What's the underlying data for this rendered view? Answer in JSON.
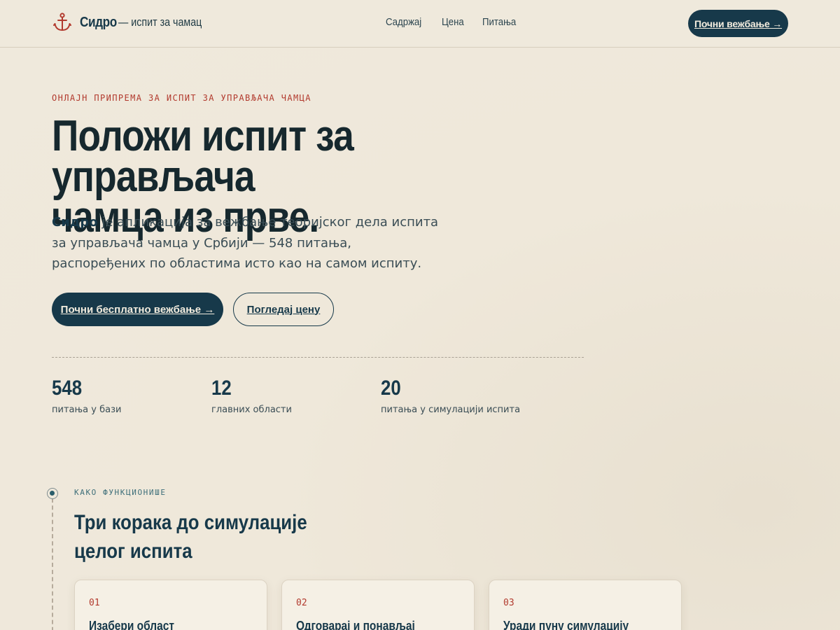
{
  "header": {
    "brand_name": "Сидро",
    "brand_tagline": "— испит за чамац",
    "nav": [
      "Садржај",
      "Цена",
      "Питања"
    ],
    "cta_label": "Почни вежбање →"
  },
  "hero": {
    "eyebrow": "ОНЛАЈН ПРИПРЕМА ЗА ИСПИТ ЗА УПРАВЉАЧА ЧАМЦА",
    "title_line1": "Положи испит за управљача",
    "title_line2": "чамца из прве.",
    "desc_brand": "Сидро",
    "desc_text": " је апликација за вежбање теоријског дела испита за управљача чамца у Србији — 548 питања, распоређених по областима исто као на самом испиту.",
    "primary_button": "Почни бесплатно вежбање →",
    "secondary_button": "Погледај цену"
  },
  "stats": [
    {
      "value": "548",
      "label": "питања у бази"
    },
    {
      "value": "12",
      "label": "главних области"
    },
    {
      "value": "20",
      "label": "питања у симулацији испита"
    }
  ],
  "how": {
    "eyebrow": "КАКО ФУНКЦИОНИШЕ",
    "title_line1": "Три корака до симулације",
    "title_line2": "целог испита",
    "steps": [
      {
        "num": "01",
        "title": "Изабери област"
      },
      {
        "num": "02",
        "title": "Одговарај и понављај"
      },
      {
        "num": "03",
        "title": "Уради пуну симулацију"
      }
    ]
  },
  "colors": {
    "primary": "#17394a",
    "accent": "#b23a2e",
    "background": "#efe9dc"
  },
  "icons": {
    "brand": "anchor-icon"
  }
}
